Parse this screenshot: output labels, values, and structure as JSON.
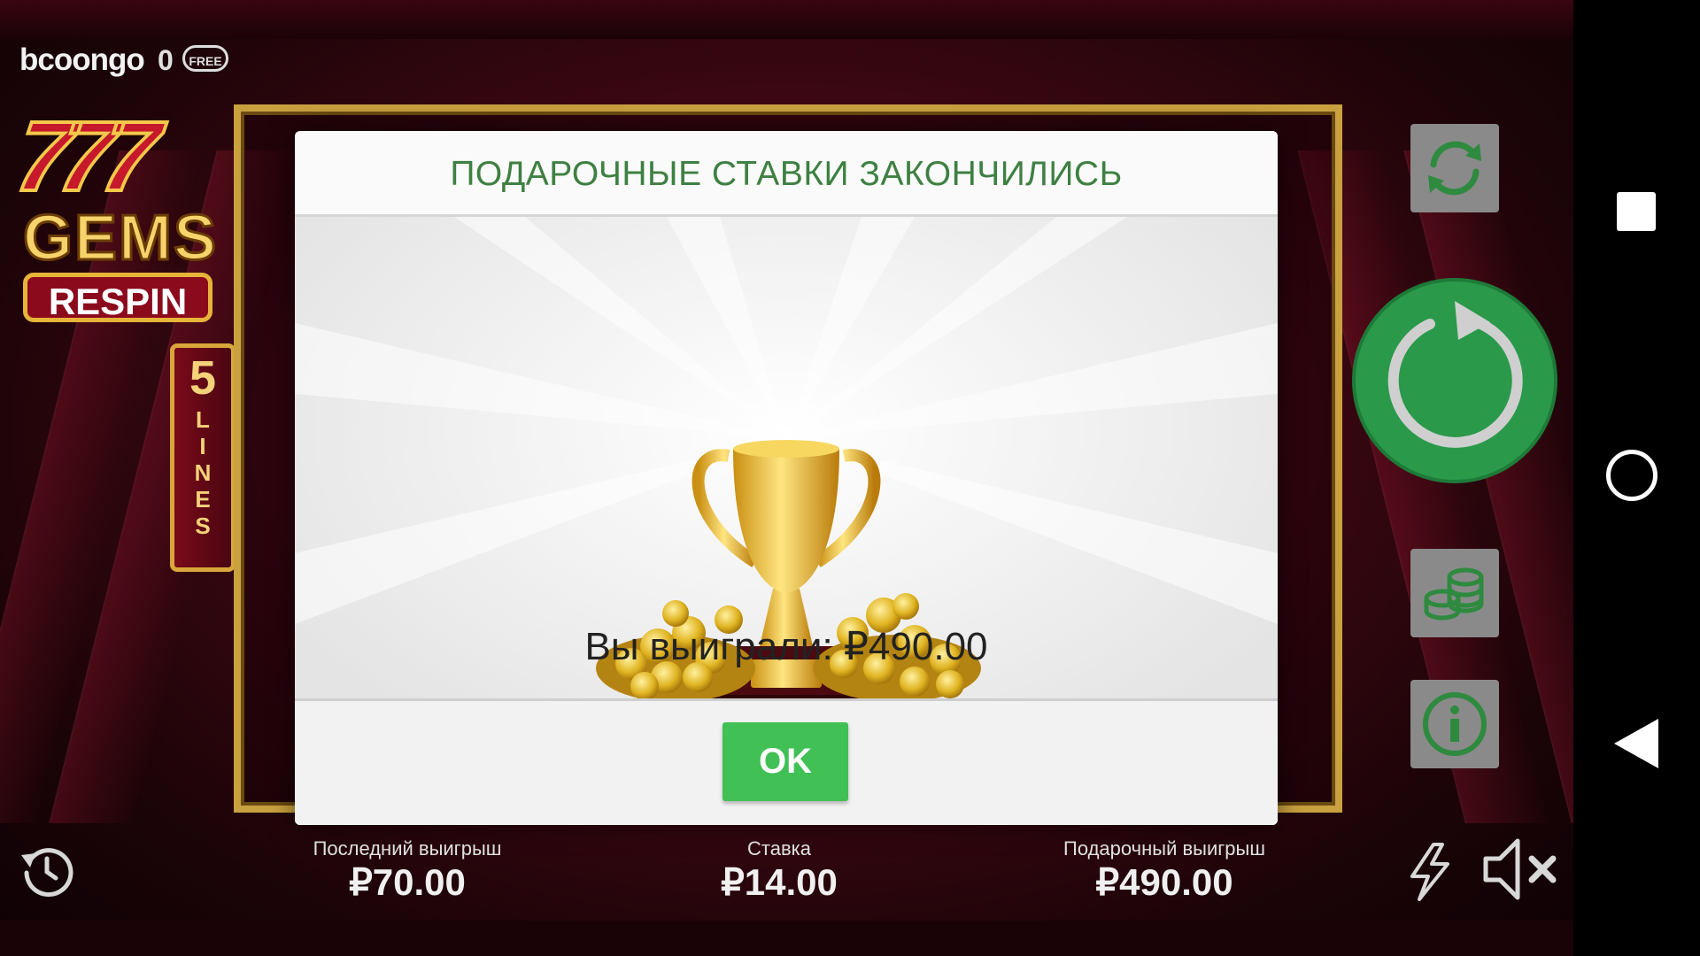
{
  "header": {
    "brand": "bcoongo",
    "free_bets_count": "0",
    "free_badge": "FREE"
  },
  "game_logo": {
    "numbers": "777",
    "title": "GEMS",
    "subtitle": "RESPIN",
    "lines_count": "5",
    "lines_label": "LINES"
  },
  "dialog": {
    "title": "ПОДАРОЧНЫЕ СТАВКИ ЗАКОНЧИЛИСЬ",
    "message": "Вы выиграли: ₽490.00",
    "ok_label": "OK"
  },
  "stats": {
    "last_win": {
      "label": "Последний выигрыш",
      "value": "₽70.00"
    },
    "bet": {
      "label": "Ставка",
      "value": "₽14.00"
    },
    "gift_win": {
      "label": "Подарочный выигрыш",
      "value": "₽490.00"
    }
  },
  "controls": {
    "autoplay_icon": "refresh-icon",
    "spin_icon": "spin-arrow-icon",
    "bet_icon": "coins-icon",
    "info_icon": "info-icon",
    "history_icon": "history-icon",
    "turbo_icon": "lightning-icon",
    "sound_icon": "speaker-muted-icon"
  },
  "colors": {
    "title_green": "#3e8042",
    "ok_green": "#40c055",
    "spin_green": "#2a9a4a",
    "frame_gold": "#c9a13f"
  }
}
